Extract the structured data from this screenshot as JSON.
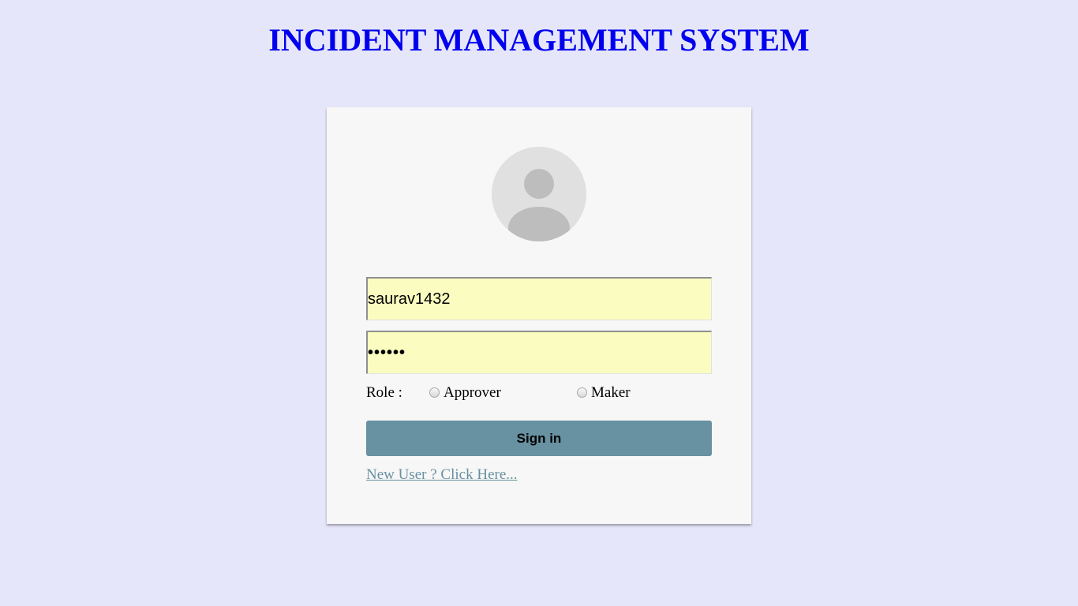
{
  "header": {
    "title": "INCIDENT MANAGEMENT SYSTEM"
  },
  "login": {
    "avatar_icon": "user-avatar-icon",
    "username_value": "saurav1432",
    "password_value": "••••••",
    "role_label": "Role :",
    "roles": [
      {
        "label": "Approver",
        "selected": false
      },
      {
        "label": "Maker",
        "selected": false
      }
    ],
    "signin_label": "Sign in",
    "new_user_link": "New User ? Click Here..."
  },
  "colors": {
    "page_background": "#e6e6fa",
    "title": "#0000ee",
    "card_background": "#f7f7f7",
    "input_background": "#fafdbf",
    "button": "#6891a2",
    "link": "#6891a2"
  }
}
